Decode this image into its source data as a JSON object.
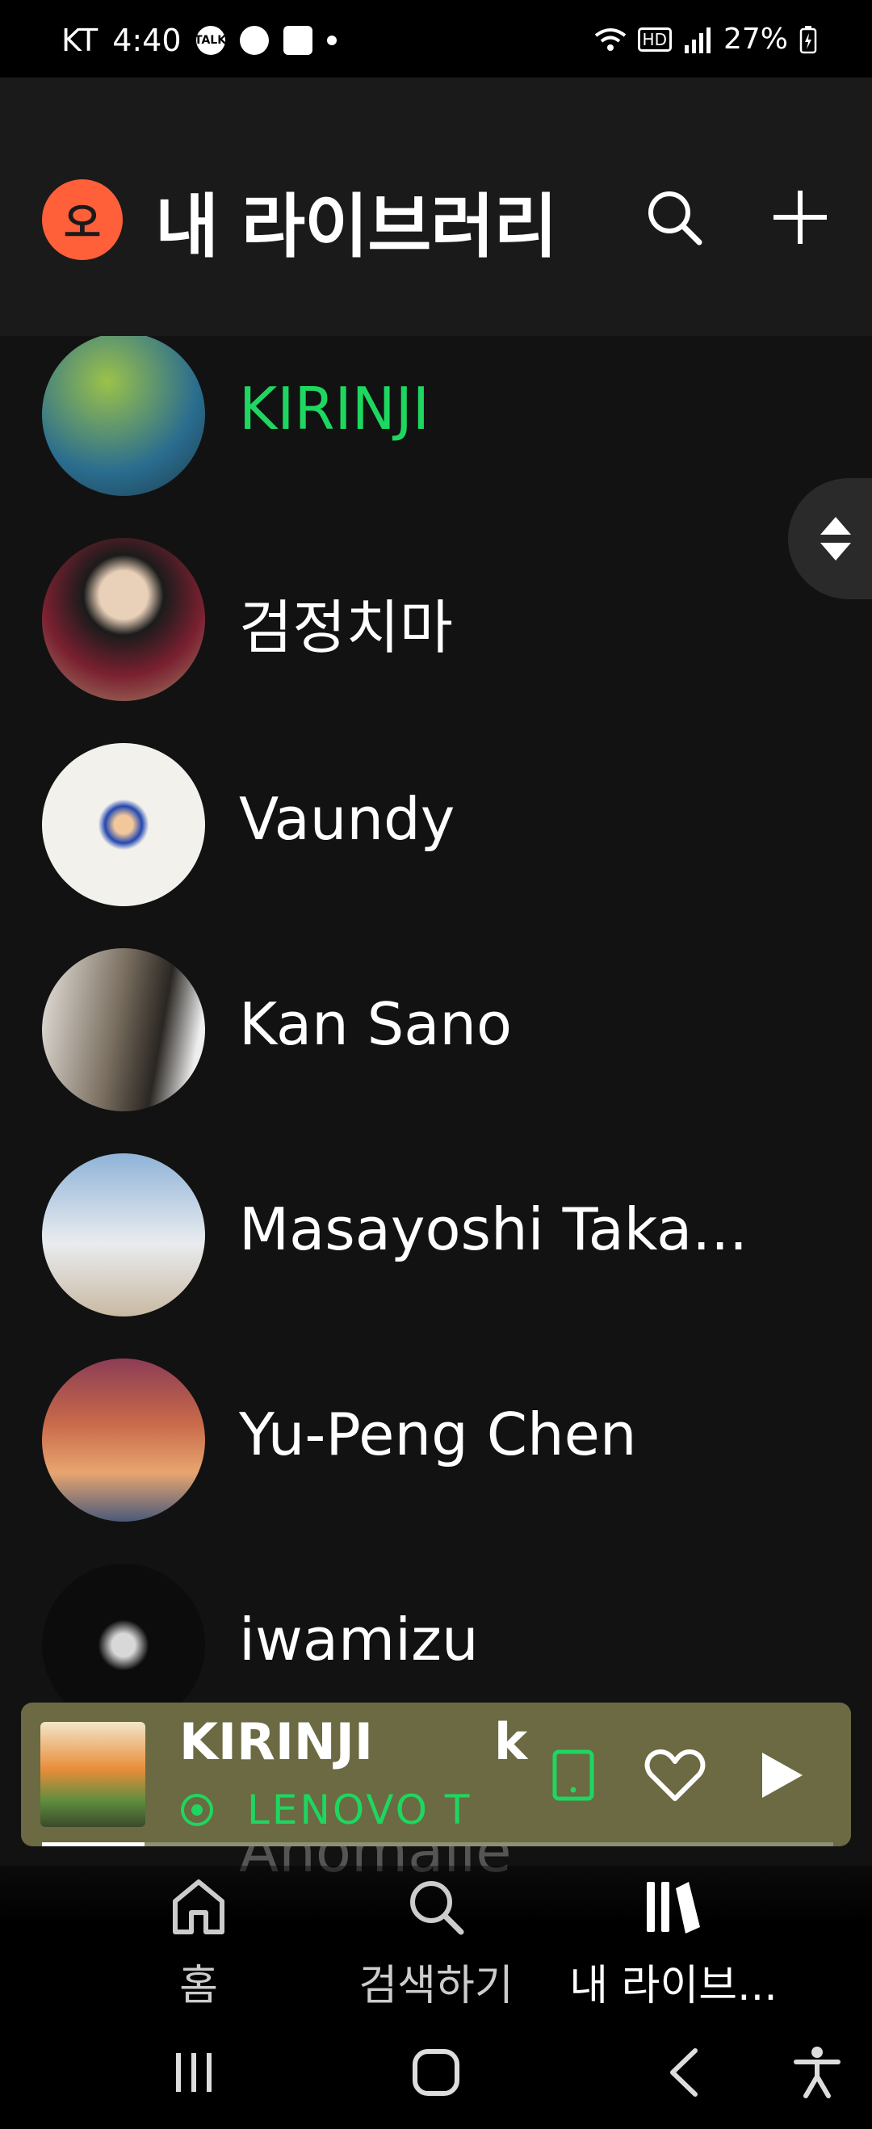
{
  "status_bar": {
    "carrier": "KT",
    "time": "4:40",
    "hd": "HD",
    "battery": "27%"
  },
  "header": {
    "avatar_letter": "오",
    "title": "내 라이브러리"
  },
  "artists": [
    {
      "name": "KIRINJI",
      "active": true
    },
    {
      "name": "검정치마"
    },
    {
      "name": "Vaundy"
    },
    {
      "name": "Kan Sano"
    },
    {
      "name": "Masayoshi Taka..."
    },
    {
      "name": "Yu-Peng Chen"
    },
    {
      "name": "iwamizu"
    }
  ],
  "partial_artist": "Anomalie",
  "mini_player": {
    "title": "KIRINJI",
    "title_tail": "k",
    "device": "LENOVO T",
    "progress": 0.13
  },
  "bottom_nav": [
    {
      "label": "홈"
    },
    {
      "label": "검색하기"
    },
    {
      "label": "내 라이브..."
    }
  ],
  "colors": {
    "accent": "#1ed760",
    "avatar": "#ff5f39",
    "player_bg": "#6b6a42"
  }
}
